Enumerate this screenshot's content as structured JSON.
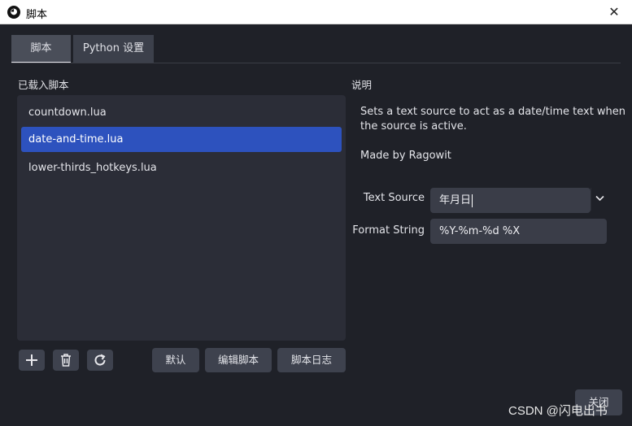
{
  "window": {
    "title": "脚本",
    "app_icon": "obs-logo-icon",
    "close_glyph": "✕"
  },
  "tabs": [
    {
      "label": "脚本",
      "active": true
    },
    {
      "label": "Python 设置",
      "active": false
    }
  ],
  "loaded_scripts": {
    "heading": "已载入脚本",
    "items": [
      {
        "label": "countdown.lua",
        "selected": false
      },
      {
        "label": "date-and-time.lua",
        "selected": true
      },
      {
        "label": "lower-thirds_hotkeys.lua",
        "selected": false
      }
    ]
  },
  "toolbar": {
    "add_icon": "plus-icon",
    "remove_icon": "trash-icon",
    "reload_icon": "refresh-icon",
    "defaults_label": "默认",
    "edit_label": "编辑脚本",
    "log_label": "脚本日志"
  },
  "description": {
    "heading": "说明",
    "line1": "Sets a text source to act as a date/time text when",
    "line2": "the source is active.",
    "author": "Made by Ragowit"
  },
  "settings": {
    "text_source_label": "Text Source",
    "text_source_value": "年月日",
    "format_string_label": "Format String",
    "format_string_value": "%Y-%m-%d %X"
  },
  "footer": {
    "close_label": "关闭",
    "watermark": "CSDN @闪电出书"
  },
  "colors": {
    "background": "#1f2128",
    "panel": "#2b2d37",
    "selection": "#2d52be",
    "button": "#3e424e"
  }
}
